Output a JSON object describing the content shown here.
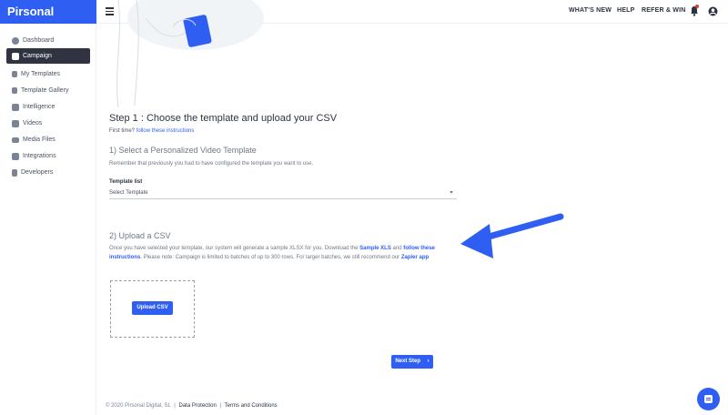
{
  "brand": {
    "name": "Pirsonal"
  },
  "topnav": {
    "whats_new": "WHAT'S NEW",
    "help": "HELP",
    "refer": "REFER & WIN"
  },
  "sidebar": {
    "items": [
      {
        "label": "Dashboard"
      },
      {
        "label": "Campaign"
      },
      {
        "label": "My Templates"
      },
      {
        "label": "Template Gallery"
      },
      {
        "label": "Intelligence"
      },
      {
        "label": "Videos"
      },
      {
        "label": "Media Files"
      },
      {
        "label": "Integrations"
      },
      {
        "label": "Developers"
      }
    ]
  },
  "main": {
    "step_title": "Step 1 : Choose the template and upload your CSV",
    "first_time_prefix": "First time?",
    "first_time_link": "follow these instructions",
    "section1_title": "1) Select a Personalized Video Template",
    "section1_text": "Remember that previously you had to have configured the template you want to use.",
    "template_label": "Template list",
    "template_value": "Select Template",
    "section2_title": "2) Upload a CSV",
    "csv_text_1": "Once you have selected your template, our system will generate a sample XLSX for you. Download the",
    "csv_sample_link": "Sample XLS",
    "csv_and": "and",
    "csv_follow_link": "follow these instructions",
    "csv_text_2": ". Please note: Campaign is limited to batches of up to 300 rows. For larger batches, we still recommend our",
    "csv_zapier_link": "Zapier app",
    "upload_button": "Upload CSV",
    "next_button": "Next Step"
  },
  "footer": {
    "copyright": "© 2020 Pirsonal Digital, SL",
    "data_protection": "Data Protection",
    "terms": "Terms and Conditions",
    "separator": "|"
  },
  "icons": {
    "menu": "hamburger-icon",
    "bell": "bell-icon",
    "user": "user-icon",
    "chat": "chat-icon",
    "next": "chevron-right-icon"
  },
  "colors": {
    "brand": "#2f5ff2",
    "sidebar_active": "#2f3440",
    "notification": "#e53935"
  }
}
